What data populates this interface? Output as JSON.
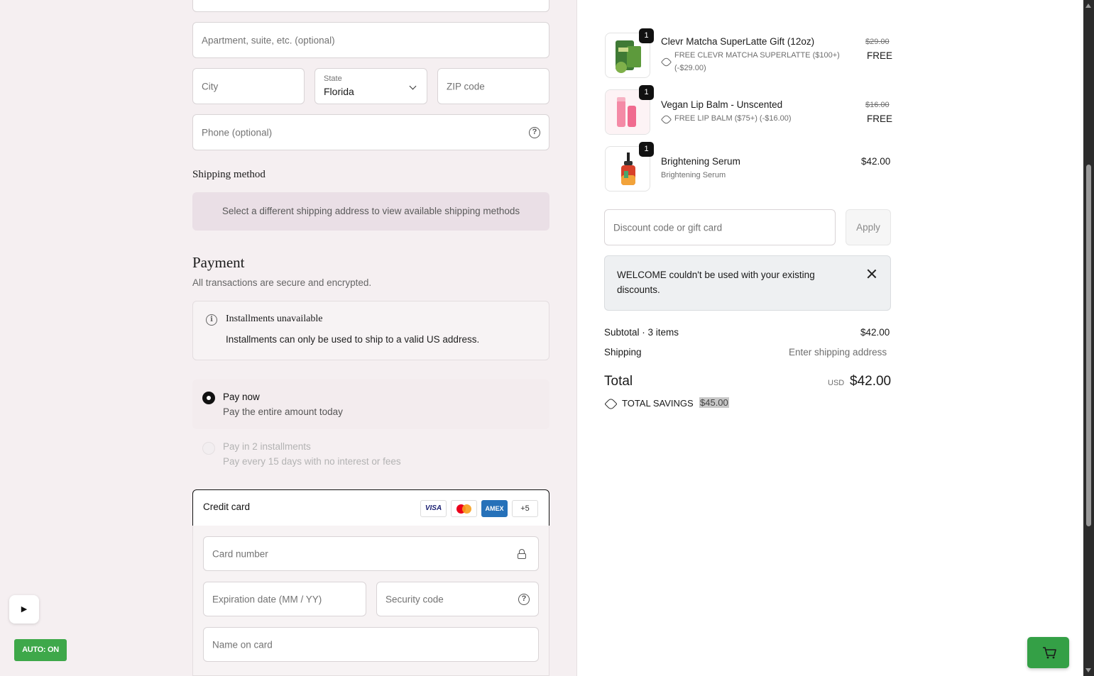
{
  "address": {
    "apartment_placeholder": "Apartment, suite, etc. (optional)",
    "city_placeholder": "City",
    "state_label": "State",
    "state_value": "Florida",
    "zip_placeholder": "ZIP code",
    "phone_placeholder": "Phone (optional)"
  },
  "shipping": {
    "heading": "Shipping method",
    "notice": "Select a different shipping address to view available shipping methods"
  },
  "payment": {
    "heading": "Payment",
    "subtitle": "All transactions are secure and encrypted.",
    "installments_title": "Installments unavailable",
    "installments_text": "Installments can only be used to ship to a valid US address.",
    "options": [
      {
        "title": "Pay now",
        "desc": "Pay the entire amount today",
        "selected": true
      },
      {
        "title": "Pay in 2 installments",
        "desc": "Pay every 15 days with no interest or fees",
        "disabled": true
      }
    ],
    "credit_card_label": "Credit card",
    "card_logos": [
      "VISA",
      "Mastercard",
      "AMEX",
      "+5"
    ],
    "card_number_placeholder": "Card number",
    "expiry_placeholder": "Expiration date (MM / YY)",
    "security_placeholder": "Security code",
    "name_placeholder": "Name on card"
  },
  "overlay": {
    "play_symbol": "▶",
    "auto_label": "AUTO: ON"
  },
  "cart": {
    "items": [
      {
        "name": "Clevr Matcha SuperLatte Gift (12oz)",
        "qty": "1",
        "discount": "FREE CLEVR MATCHA SUPERLATTE ($100+)",
        "discount_amount": "(-$29.00)",
        "original_price": "$29.00",
        "price": "FREE"
      },
      {
        "name": "Vegan Lip Balm - Unscented",
        "qty": "1",
        "discount": "FREE LIP BALM ($75+) (-$16.00)",
        "original_price": "$16.00",
        "price": "FREE"
      },
      {
        "name": "Brightening Serum",
        "qty": "1",
        "variant": "Brightening Serum",
        "price": "$42.00"
      }
    ],
    "discount_placeholder": "Discount code or gift card",
    "apply_label": "Apply",
    "warning": "WELCOME couldn't be used with your existing discounts.",
    "subtotal_label": "Subtotal · 3 items",
    "subtotal_value": "$42.00",
    "shipping_label": "Shipping",
    "shipping_value": "Enter shipping address",
    "total_label": "Total",
    "currency": "USD",
    "total_value": "$42.00",
    "savings_label": "TOTAL SAVINGS",
    "savings_value": "$45.00"
  },
  "colors": {
    "left_bg": "#f5eff1",
    "accent_green": "#3ea84a",
    "notice_bg": "#eadfe6"
  }
}
